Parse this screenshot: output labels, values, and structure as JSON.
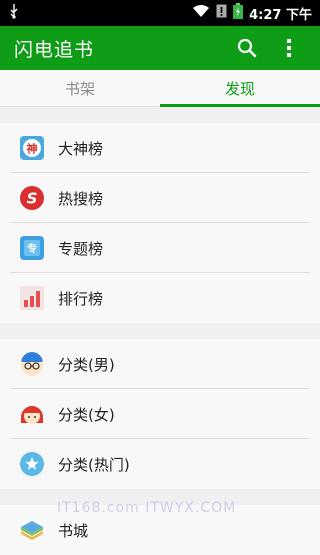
{
  "status_bar": {
    "time": "4:27 下午"
  },
  "app_bar": {
    "title": "闪电追书"
  },
  "tabs": [
    {
      "label": "书架",
      "active": false
    },
    {
      "label": "发现",
      "active": true
    }
  ],
  "groups": [
    {
      "items": [
        {
          "label": "大神榜",
          "icon": "shen-badge-icon"
        },
        {
          "label": "热搜榜",
          "icon": "hot-search-s-icon"
        },
        {
          "label": "专题榜",
          "icon": "topic-badge-icon"
        },
        {
          "label": "排行榜",
          "icon": "ranking-bars-icon"
        }
      ]
    },
    {
      "items": [
        {
          "label": "分类(男)",
          "icon": "boy-avatar-icon"
        },
        {
          "label": "分类(女)",
          "icon": "girl-avatar-icon"
        },
        {
          "label": "分类(热门)",
          "icon": "star-circle-icon"
        }
      ]
    },
    {
      "items": [
        {
          "label": "书城",
          "icon": "bookstore-icon"
        }
      ]
    }
  ],
  "watermark": "IT168.com  ITWYX.COM",
  "colors": {
    "brand": "#0f9c17"
  }
}
